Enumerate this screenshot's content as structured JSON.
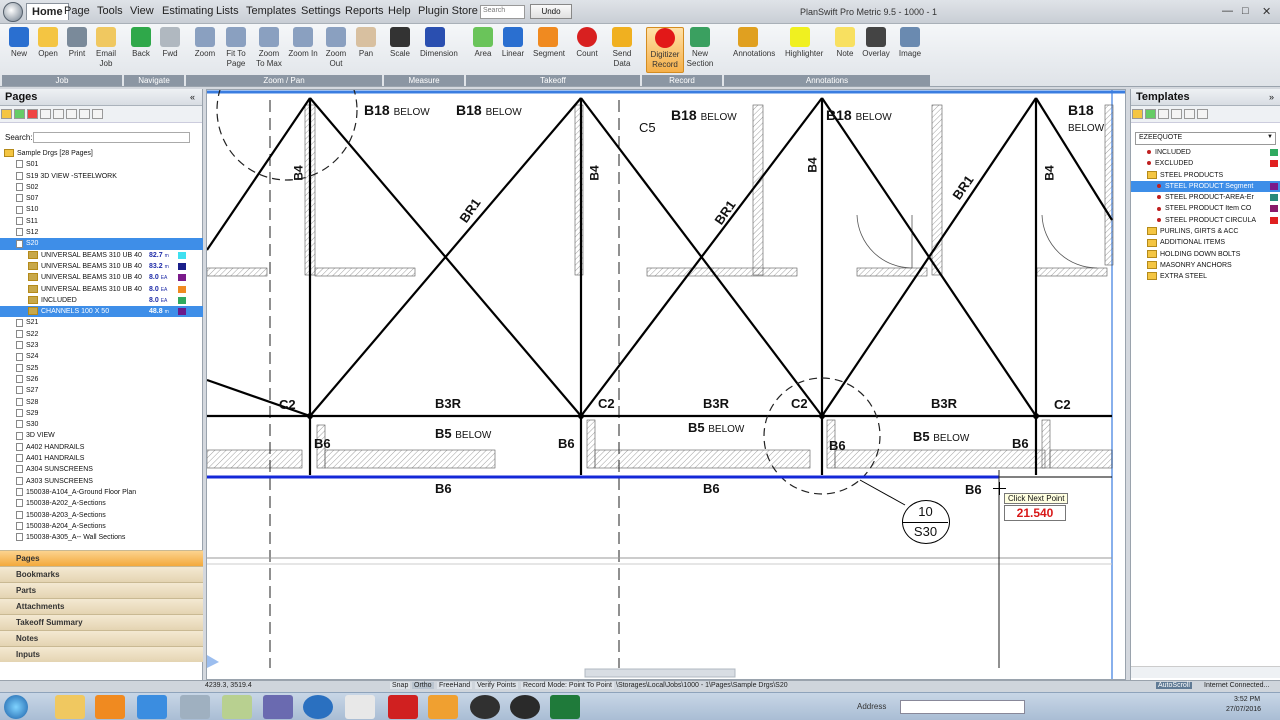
{
  "titlebar": {
    "menus": [
      "Home",
      "Page",
      "Tools",
      "View",
      "Estimating",
      "Lists",
      "Templates",
      "Settings",
      "Reports",
      "Help",
      "Plugin Store"
    ],
    "search_placeholder": "Search",
    "undo_label": "Undo",
    "window_title": "PlanSwift Pro Metric 9.5 - 1000 - 1"
  },
  "ribbon": {
    "buttons": [
      {
        "label": "New",
        "icon": "new-icon"
      },
      {
        "label": "Open",
        "icon": "open-folder-icon"
      },
      {
        "label": "Print",
        "icon": "printer-icon"
      },
      {
        "label": "Email Job",
        "icon": "email-icon"
      },
      {
        "label": "Back",
        "icon": "back-arrow-icon"
      },
      {
        "label": "Fwd",
        "icon": "forward-arrow-icon"
      },
      {
        "label": "Zoom",
        "icon": "zoom-icon"
      },
      {
        "label": "Fit To Page",
        "icon": "fit-page-icon"
      },
      {
        "label": "Zoom To Max",
        "icon": "zoom-max-icon"
      },
      {
        "label": "Zoom In",
        "icon": "zoom-in-icon"
      },
      {
        "label": "Zoom Out",
        "icon": "zoom-out-icon"
      },
      {
        "label": "Pan",
        "icon": "pan-hand-icon"
      },
      {
        "label": "Scale",
        "icon": "scale-icon"
      },
      {
        "label": "Dimension",
        "icon": "dimension-icon"
      },
      {
        "label": "Area",
        "icon": "area-icon"
      },
      {
        "label": "Linear",
        "icon": "linear-icon"
      },
      {
        "label": "Segment",
        "icon": "segment-icon"
      },
      {
        "label": "Count",
        "icon": "count-icon"
      },
      {
        "label": "Send Data",
        "icon": "send-data-icon"
      },
      {
        "label": "Digitizer Record",
        "icon": "record-icon"
      },
      {
        "label": "New Section",
        "icon": "new-section-icon"
      },
      {
        "label": "Annotations",
        "icon": "annotations-icon"
      },
      {
        "label": "Highlighter",
        "icon": "highlighter-icon"
      },
      {
        "label": "Note",
        "icon": "note-icon"
      },
      {
        "label": "Overlay",
        "icon": "overlay-icon"
      },
      {
        "label": "Image",
        "icon": "image-icon"
      }
    ],
    "groups": [
      "Job",
      "Navigate",
      "Zoom / Pan",
      "Measure",
      "Takeoff",
      "Record",
      "Annotations"
    ]
  },
  "pages_panel": {
    "title": "Pages",
    "search_label": "Search:",
    "tree": [
      {
        "label": "Sample Drgs [28 Pages]",
        "type": "folder",
        "indent": 0
      },
      {
        "label": "S01",
        "type": "page",
        "indent": 1
      },
      {
        "label": "S19 3D VIEW -STEELWORK",
        "type": "page",
        "indent": 1
      },
      {
        "label": "S02",
        "type": "page",
        "indent": 1
      },
      {
        "label": "S07",
        "type": "page",
        "indent": 1
      },
      {
        "label": "S10",
        "type": "page",
        "indent": 1
      },
      {
        "label": "S11",
        "type": "page",
        "indent": 1
      },
      {
        "label": "S12",
        "type": "page",
        "indent": 1
      },
      {
        "label": "S20",
        "type": "page",
        "indent": 1,
        "selected": true
      },
      {
        "label": "UNIVERSAL BEAMS 310 UB 40",
        "type": "item",
        "indent": 2,
        "value": "82.7",
        "unit": "m",
        "color": "#3fe0f0"
      },
      {
        "label": "UNIVERSAL BEAMS 310 UB 40",
        "type": "item",
        "indent": 2,
        "value": "83.2",
        "unit": "m",
        "color": "#1a1f8a"
      },
      {
        "label": "UNIVERSAL BEAMS 310 UB 40",
        "type": "item",
        "indent": 2,
        "value": "8.0",
        "unit": "EA",
        "color": "#7a1a8a"
      },
      {
        "label": "UNIVERSAL BEAMS 310 UB 40",
        "type": "item",
        "indent": 2,
        "value": "8.0",
        "unit": "EA",
        "color": "#f08a20"
      },
      {
        "label": "INCLUDED",
        "type": "item",
        "indent": 2,
        "value": "8.0",
        "unit": "EA",
        "color": "#2faa60"
      },
      {
        "label": "CHANNELS 100 X 50",
        "type": "item",
        "indent": 2,
        "value": "48.8",
        "unit": "m",
        "color": "#6a1a8a",
        "selected": true
      },
      {
        "label": "S21",
        "type": "page",
        "indent": 1
      },
      {
        "label": "S22",
        "type": "page",
        "indent": 1
      },
      {
        "label": "S23",
        "type": "page",
        "indent": 1
      },
      {
        "label": "S24",
        "type": "page",
        "indent": 1
      },
      {
        "label": "S25",
        "type": "page",
        "indent": 1
      },
      {
        "label": "S26",
        "type": "page",
        "indent": 1
      },
      {
        "label": "S27",
        "type": "page",
        "indent": 1
      },
      {
        "label": "S28",
        "type": "page",
        "indent": 1
      },
      {
        "label": "S29",
        "type": "page",
        "indent": 1
      },
      {
        "label": "S30",
        "type": "page",
        "indent": 1
      },
      {
        "label": "3D VIEW",
        "type": "page",
        "indent": 1
      },
      {
        "label": "A402 HANDRAILS",
        "type": "page",
        "indent": 1
      },
      {
        "label": "A401 HANDRAILS",
        "type": "page",
        "indent": 1
      },
      {
        "label": "A304 SUNSCREENS",
        "type": "page",
        "indent": 1
      },
      {
        "label": "A303 SUNSCREENS",
        "type": "page",
        "indent": 1
      },
      {
        "label": "150038-A104_A-Ground Floor Plan",
        "type": "page",
        "indent": 1
      },
      {
        "label": "150038-A202_A-Sections",
        "type": "page",
        "indent": 1
      },
      {
        "label": "150038-A203_A-Sections",
        "type": "page",
        "indent": 1
      },
      {
        "label": "150038-A204_A-Sections",
        "type": "page",
        "indent": 1
      },
      {
        "label": "150038-A305_A-- Wall Sections",
        "type": "page",
        "indent": 1
      }
    ],
    "accordion": [
      "Pages",
      "Bookmarks",
      "Parts",
      "Attachments",
      "Takeoff Summary",
      "Notes",
      "Inputs"
    ]
  },
  "drawing": {
    "top_labels": [
      "B18",
      "B18",
      "B18",
      "B18",
      "B18"
    ],
    "below": "BELOW",
    "c5": "C5",
    "b4": "B4",
    "br1": "BR1",
    "b3r": "B3R",
    "c2": "C2",
    "b5": "B5",
    "b6": "B6",
    "callout_top": "10",
    "callout_bottom": "S30",
    "tooltip": "Click Next Point",
    "measure_value": "21.540"
  },
  "templates_panel": {
    "title": "Templates",
    "dropdown_value": "EZEEQUOTE",
    "tree": [
      {
        "label": "INCLUDED",
        "indent": 1,
        "color": "#2faa60"
      },
      {
        "label": "EXCLUDED",
        "indent": 1,
        "color": "#e02020"
      },
      {
        "label": "STEEL PRODUCTS",
        "indent": 1,
        "folder": true
      },
      {
        "label": "STEEL PRODUCT Segment",
        "indent": 2,
        "color": "#7a1a8a",
        "selected": true
      },
      {
        "label": "STEEL PRODUCT-AREA-Er",
        "indent": 2,
        "color": "#2a8a7a"
      },
      {
        "label": "STEEL PRODUCT  Item CO",
        "indent": 2,
        "color": "#8a1a6a"
      },
      {
        "label": "STEEL PRODUCT CIRCULA",
        "indent": 2,
        "color": "#e02020"
      },
      {
        "label": "PURLINS, GIRTS & ACC",
        "indent": 1,
        "folder": true
      },
      {
        "label": "ADDITIONAL ITEMS",
        "indent": 1,
        "folder": true
      },
      {
        "label": "HOLDING DOWN BOLTS",
        "indent": 1,
        "folder": true
      },
      {
        "label": "MASONRY ANCHORS",
        "indent": 1,
        "folder": true
      },
      {
        "label": "EXTRA STEEL",
        "indent": 1,
        "folder": true
      }
    ]
  },
  "statusbar": {
    "coords": "4239.3, 3519.4",
    "items": [
      "Snap",
      "Ortho",
      "FreeHand",
      "Verify Points",
      "Record Mode: Point To Point"
    ],
    "path": "\\Storages\\Local\\Jobs\\1000 - 1\\Pages\\Sample Drgs\\S20",
    "autoscroll": "AutoScroll",
    "connection": "Internet Connected..."
  },
  "taskbar": {
    "address_label": "Address",
    "time": "3:52 PM",
    "date": "27/07/2016"
  }
}
